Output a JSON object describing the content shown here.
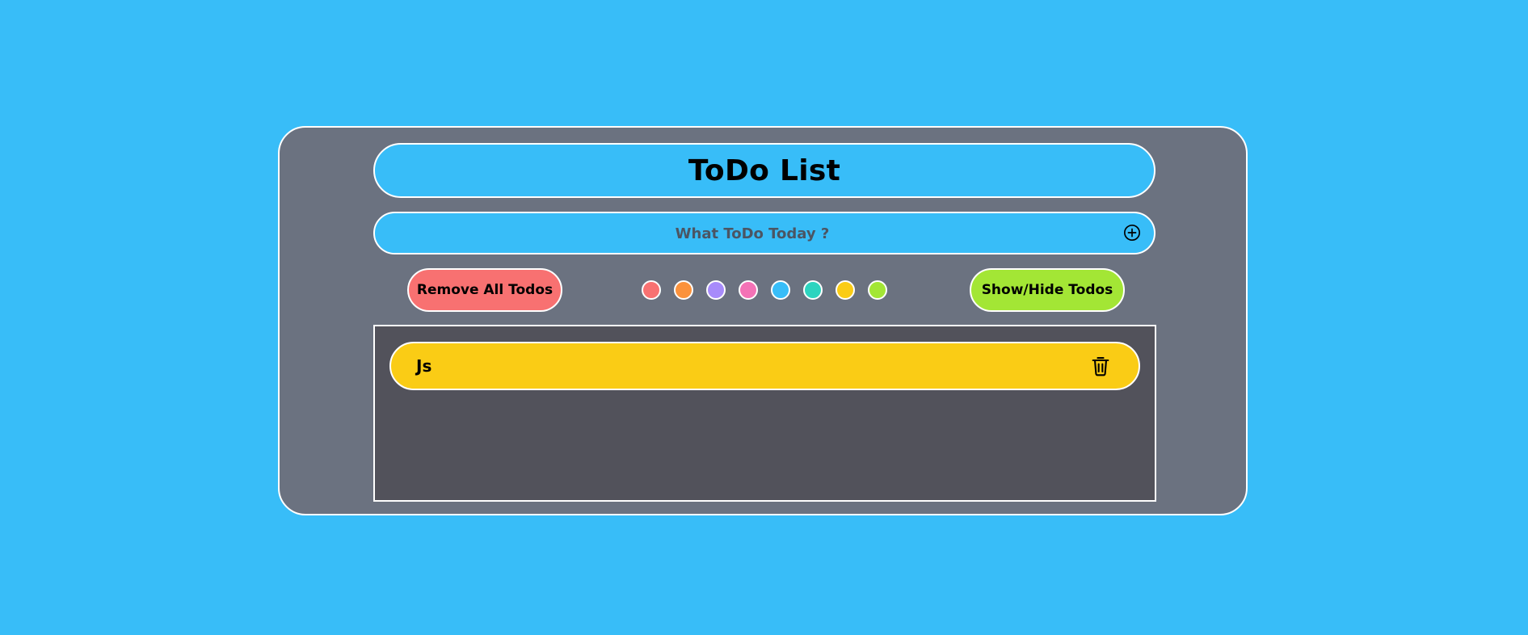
{
  "app": {
    "title": "ToDo List"
  },
  "input": {
    "placeholder": "What ToDo Today ?",
    "value": "",
    "add_icon": "plus-circle-icon"
  },
  "controls": {
    "remove_all_label": "Remove All Todos",
    "toggle_label": "Show/Hide Todos",
    "swatches": [
      {
        "name": "red",
        "color": "#f87171"
      },
      {
        "name": "orange",
        "color": "#fb923c"
      },
      {
        "name": "purple",
        "color": "#a78bfa"
      },
      {
        "name": "pink",
        "color": "#f472b6"
      },
      {
        "name": "sky",
        "color": "#38bdf8"
      },
      {
        "name": "teal",
        "color": "#2dd4bf"
      },
      {
        "name": "yellow",
        "color": "#facc15"
      },
      {
        "name": "lime",
        "color": "#a3e635"
      }
    ]
  },
  "todos": [
    {
      "text": "Js",
      "color": "#facc15",
      "delete_icon": "trash-icon"
    }
  ],
  "colors": {
    "page_background": "#38bdf8",
    "panel_background": "#6b7280",
    "list_background": "#52525b",
    "border": "#ffffff"
  }
}
